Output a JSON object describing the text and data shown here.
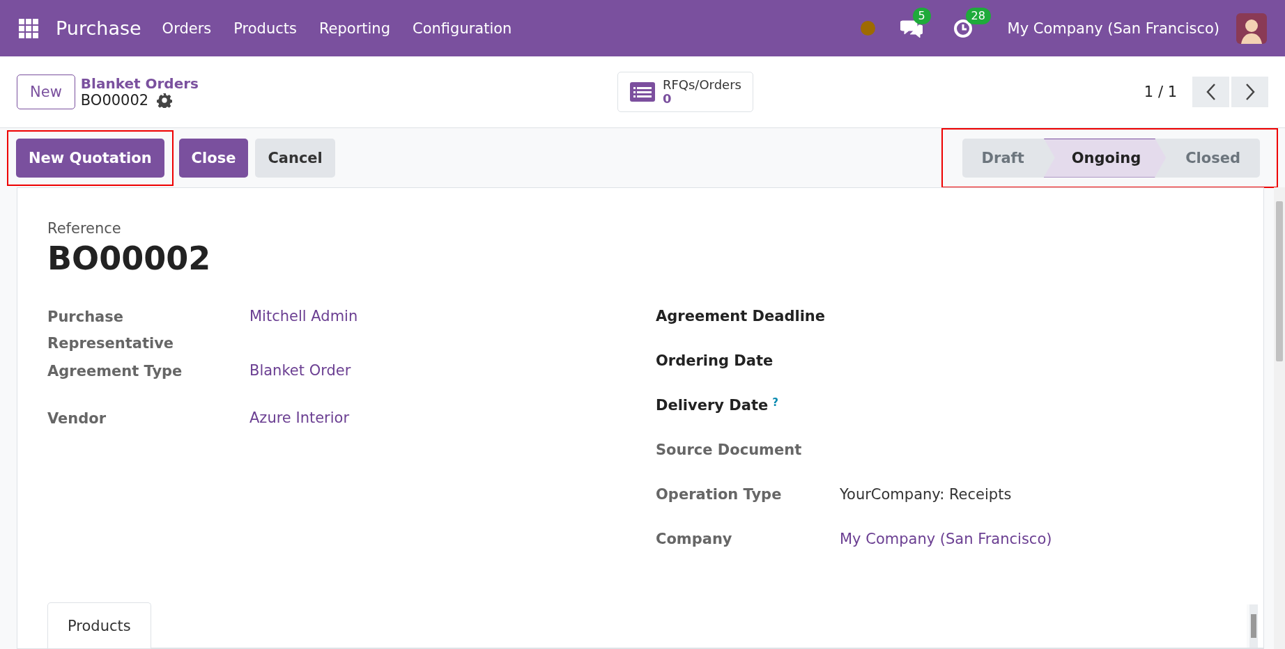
{
  "navbar": {
    "app_name": "Purchase",
    "menu": [
      "Orders",
      "Products",
      "Reporting",
      "Configuration"
    ],
    "messages_badge": "5",
    "activities_badge": "28",
    "company": "My Company (San Francisco)"
  },
  "control_panel": {
    "new_button": "New",
    "breadcrumb": "Blanket Orders",
    "record": "BO00002",
    "smart_button": {
      "label": "RFQs/Orders",
      "count": "0"
    },
    "pager": "1 / 1"
  },
  "action_buttons": [
    {
      "label": "New Quotation",
      "kind": "primary",
      "highlighted": true
    },
    {
      "label": "Close",
      "kind": "primary",
      "highlighted": false
    },
    {
      "label": "Cancel",
      "kind": "secondary",
      "highlighted": false
    }
  ],
  "status_bar": {
    "highlighted": true,
    "stages": [
      {
        "label": "Draft",
        "selected": false
      },
      {
        "label": "Ongoing",
        "selected": true
      },
      {
        "label": "Closed",
        "selected": false
      }
    ]
  },
  "form": {
    "reference_label": "Reference",
    "reference": "BO00002",
    "left_fields": [
      {
        "label": "Purchase Representative",
        "value": "Mitchell Admin",
        "required": false,
        "link": true
      },
      {
        "label": "Agreement Type",
        "value": "Blanket Order",
        "required": false,
        "link": true
      },
      {
        "label": "Vendor",
        "value": "Azure Interior",
        "required": false,
        "link": true
      }
    ],
    "right_fields": [
      {
        "label": "Agreement Deadline",
        "required": true
      },
      {
        "label": "Ordering Date",
        "required": true
      },
      {
        "label": "Delivery Date",
        "help": "?",
        "required": true
      },
      {
        "label": "Source Document",
        "required": false
      },
      {
        "label": "Operation Type",
        "value": "YourCompany: Receipts",
        "required": false,
        "link": false
      },
      {
        "label": "Company",
        "value": "My Company (San Francisco)",
        "required": false,
        "link": true
      }
    ],
    "tabs": [
      {
        "label": "Products",
        "selected": true
      }
    ]
  }
}
